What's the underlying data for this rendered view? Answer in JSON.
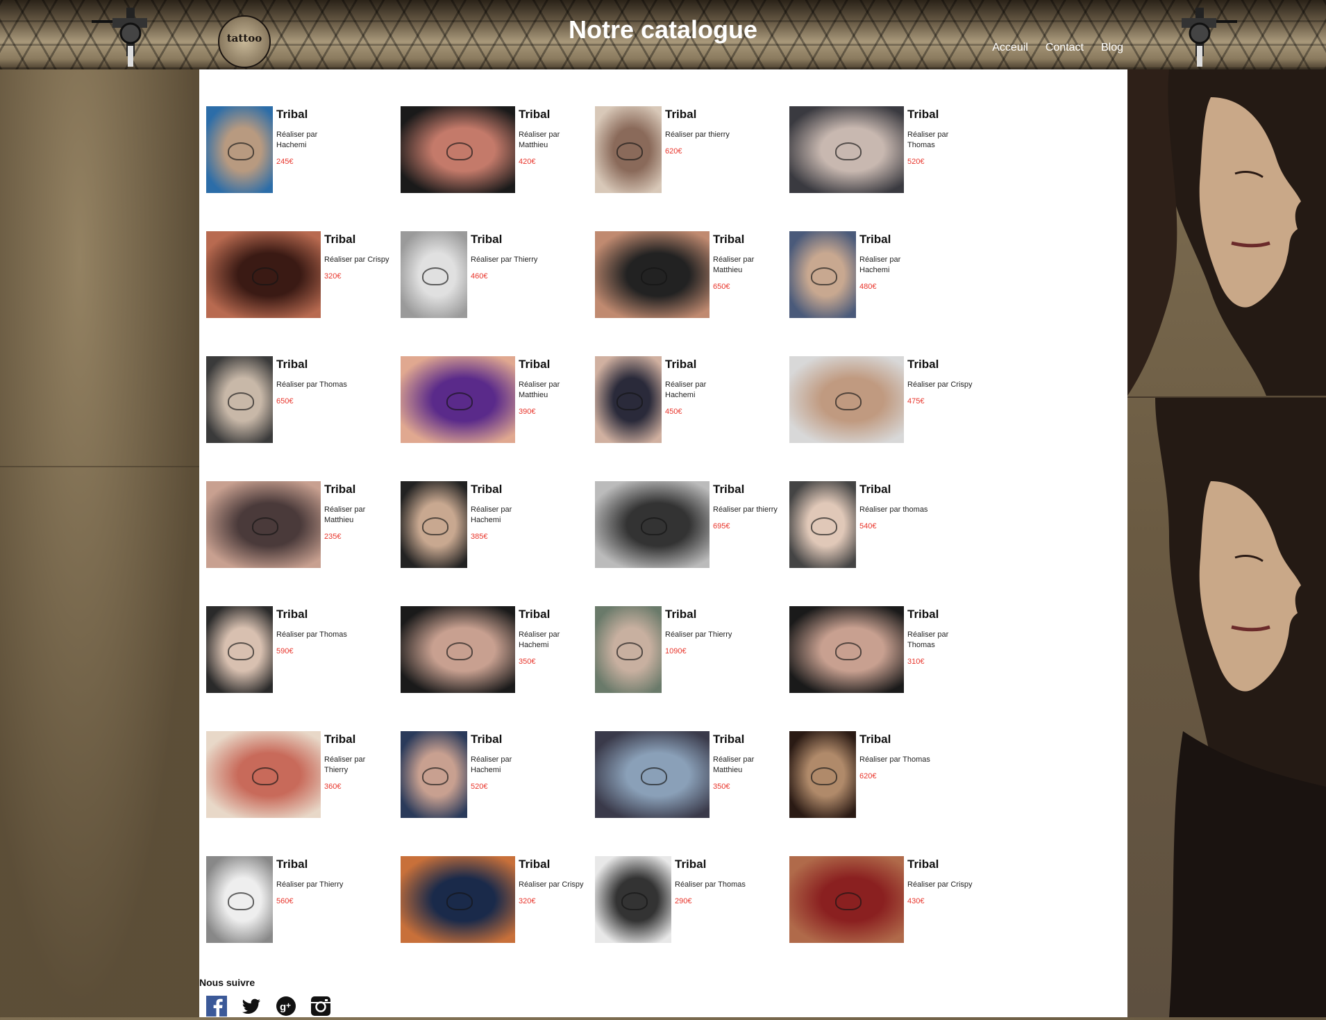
{
  "header": {
    "title": "Notre catalogue",
    "logo_text": "tattoo",
    "nav": [
      {
        "label": "Acceuil"
      },
      {
        "label": "Contact"
      },
      {
        "label": "Blog"
      }
    ]
  },
  "catalogue": [
    {
      "title": "Tribal",
      "artist": "Réaliser par Hachemi",
      "price": "245€",
      "img": "arm sleeve tattoo"
    },
    {
      "title": "Tribal",
      "artist": "Réaliser par Matthieu",
      "price": "420€",
      "img": "hip flower tattoo"
    },
    {
      "title": "Tribal",
      "artist": "Réaliser par thierry",
      "price": "620€",
      "img": "thigh tattoo"
    },
    {
      "title": "Tribal",
      "artist": "Réaliser par Thomas",
      "price": "520€",
      "img": "back tiger tattoo"
    },
    {
      "title": "Tribal",
      "artist": "Réaliser par Crispy",
      "price": "320€",
      "img": "scorpion tattoo"
    },
    {
      "title": "Tribal",
      "artist": "Réaliser par Thierry",
      "price": "460€",
      "img": "neck script tattoo"
    },
    {
      "title": "Tribal",
      "artist": "Réaliser par Matthieu",
      "price": "650€",
      "img": "lower back ladybug tattoo"
    },
    {
      "title": "Tribal",
      "artist": "Réaliser par Hachemi",
      "price": "480€",
      "img": "forearm tattoo"
    },
    {
      "title": "Tribal",
      "artist": "Réaliser par Thomas",
      "price": "650€",
      "img": "thigh mandala tattoo"
    },
    {
      "title": "Tribal",
      "artist": "Réaliser par Matthieu",
      "price": "390€",
      "img": "rose tribal tattoo"
    },
    {
      "title": "Tribal",
      "artist": "Réaliser par Hachemi",
      "price": "450€",
      "img": "shoulder floral tattoo"
    },
    {
      "title": "Tribal",
      "artist": "Réaliser par Crispy",
      "price": "475€",
      "img": "feather hip tattoo"
    },
    {
      "title": "Tribal",
      "artist": "Réaliser par Matthieu",
      "price": "235€",
      "img": "fairy lower back tattoo"
    },
    {
      "title": "Tribal",
      "artist": "Réaliser par Hachemi",
      "price": "385€",
      "img": "forearm vine tattoo"
    },
    {
      "title": "Tribal",
      "artist": "Réaliser par thierry",
      "price": "695€",
      "img": "lettering arm tattoo"
    },
    {
      "title": "Tribal",
      "artist": "Réaliser par thomas",
      "price": "540€",
      "img": "side text tattoo"
    },
    {
      "title": "Tribal",
      "artist": "Réaliser par Thomas",
      "price": "590€",
      "img": "thigh rose tattoo"
    },
    {
      "title": "Tribal",
      "artist": "Réaliser par Hachemi",
      "price": "350€",
      "img": "bow legs tattoo"
    },
    {
      "title": "Tribal",
      "artist": "Réaliser par Thierry",
      "price": "1090€",
      "img": "spine back tattoo"
    },
    {
      "title": "Tribal",
      "artist": "Réaliser par Thomas",
      "price": "310€",
      "img": "bow legs tattoo"
    },
    {
      "title": "Tribal",
      "artist": "Réaliser par Thierry",
      "price": "360€",
      "img": "owl side tattoo"
    },
    {
      "title": "Tribal",
      "artist": "Réaliser par Hachemi",
      "price": "520€",
      "img": "back floral tattoo"
    },
    {
      "title": "Tribal",
      "artist": "Réaliser par Matthieu",
      "price": "350€",
      "img": "leg stripes tattoo"
    },
    {
      "title": "Tribal",
      "artist": "Réaliser par Thomas",
      "price": "620€",
      "img": "shoulder tattoo"
    },
    {
      "title": "Tribal",
      "artist": "Réaliser par Thierry",
      "price": "560€",
      "img": "nape mandala tattoo"
    },
    {
      "title": "Tribal",
      "artist": "Réaliser par Crispy",
      "price": "320€",
      "img": "lower back script tattoo"
    },
    {
      "title": "Tribal",
      "artist": "Réaliser par Thomas",
      "price": "290€",
      "img": "thigh garter tattoo"
    },
    {
      "title": "Tribal",
      "artist": "Réaliser par Crispy",
      "price": "430€",
      "img": "forearm rose tattoo"
    }
  ],
  "footer": {
    "follow_label": "Nous suivre",
    "social": [
      {
        "icon": "facebook-icon"
      },
      {
        "icon": "twitter-icon"
      },
      {
        "icon": "google-plus-icon"
      },
      {
        "icon": "instagram-icon"
      }
    ]
  }
}
